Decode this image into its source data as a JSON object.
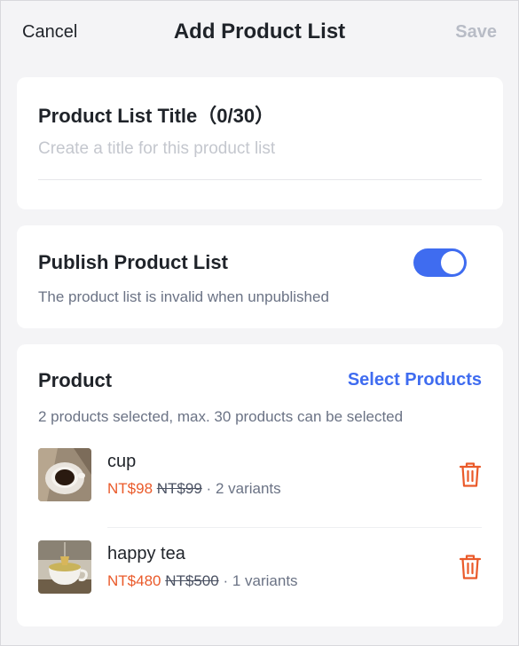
{
  "header": {
    "cancel_label": "Cancel",
    "title": "Add Product List",
    "save_label": "Save"
  },
  "title_section": {
    "label": "Product List Title（0/30）",
    "placeholder": "Create a title for this product list",
    "value": ""
  },
  "publish_section": {
    "label": "Publish Product List",
    "description": "The product list is invalid when unpublished",
    "toggle_on": true
  },
  "product_section": {
    "label": "Product",
    "select_label": "Select Products",
    "count_text": "2 products selected, max. 30 products can be selected",
    "items": [
      {
        "name": "cup",
        "price": "NT$98",
        "original_price": "NT$99",
        "separator": "·",
        "variants": "2 variants",
        "image": "cup-photo"
      },
      {
        "name": "happy tea",
        "price": "NT$480",
        "original_price": "NT$500",
        "separator": "·",
        "variants": "1 variants",
        "image": "tea-photo"
      }
    ]
  },
  "colors": {
    "accent": "#3f6cf0",
    "price": "#ea5a2a",
    "disabled": "#b8bcc6",
    "background": "#f4f4f6"
  }
}
